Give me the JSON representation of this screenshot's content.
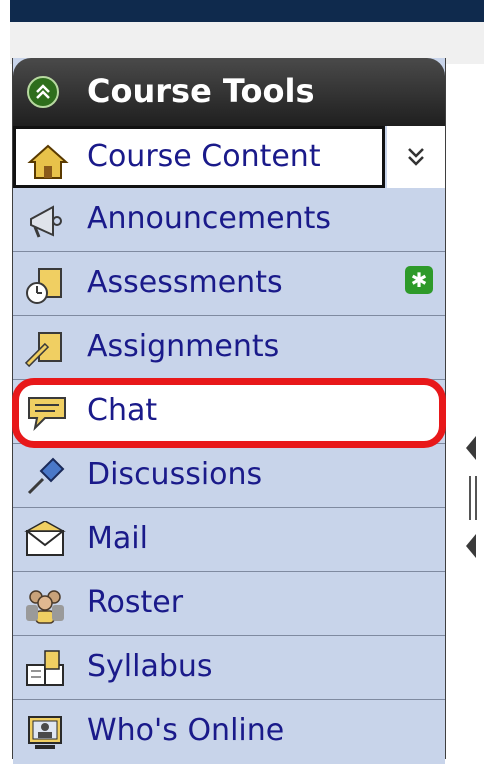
{
  "panel": {
    "title": "Course Tools",
    "header_icon": "chevron-double-up-icon",
    "expand_icon": "chevron-double-down-icon"
  },
  "items": [
    {
      "label": "Course Content",
      "icon": "home-icon",
      "current": true
    },
    {
      "label": "Announcements",
      "icon": "megaphone-icon"
    },
    {
      "label": "Assessments",
      "icon": "assessment-clock-icon",
      "badge": "new-item-icon"
    },
    {
      "label": "Assignments",
      "icon": "assignment-pencil-icon"
    },
    {
      "label": "Chat",
      "icon": "chat-bubble-icon",
      "highlighted": true
    },
    {
      "label": "Discussions",
      "icon": "pushpin-icon"
    },
    {
      "label": "Mail",
      "icon": "envelope-icon"
    },
    {
      "label": "Roster",
      "icon": "people-icon"
    },
    {
      "label": "Syllabus",
      "icon": "book-icon"
    },
    {
      "label": "Who's Online",
      "icon": "monitor-user-icon"
    }
  ],
  "colors": {
    "header_bg": "#1f1f1f",
    "row_bg": "#c8d4ea",
    "link_text": "#1a1a8a",
    "highlight_border": "#e8181a",
    "badge_green": "#2e9a2a",
    "top_bar": "#0f2a4d"
  }
}
